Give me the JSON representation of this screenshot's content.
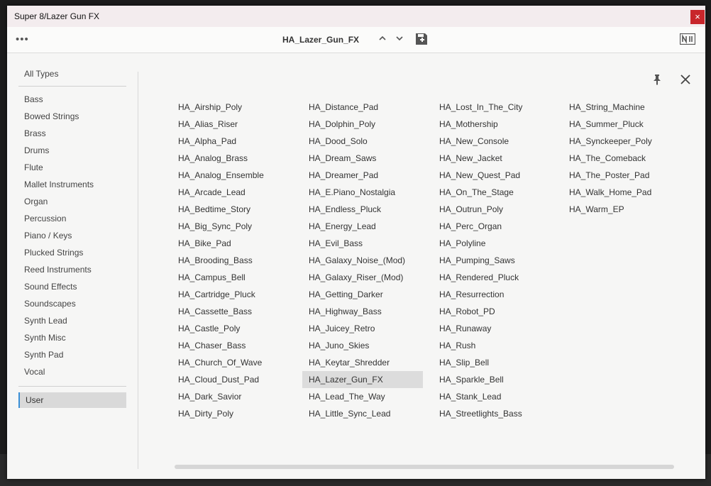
{
  "window": {
    "title": "Super 8/Lazer Gun FX",
    "close_glyph": "×"
  },
  "toolbar": {
    "menu_glyph": "•••",
    "preset_name": "HA_Lazer_Gun_FX",
    "icons": [
      "chevron-up-icon",
      "chevron-down-icon",
      "save-icon",
      "ni-logo-icon"
    ]
  },
  "browser": {
    "all_types": "All Types",
    "types": [
      "Bass",
      "Bowed Strings",
      "Brass",
      "Drums",
      "Flute",
      "Mallet Instruments",
      "Organ",
      "Percussion",
      "Piano / Keys",
      "Plucked Strings",
      "Reed Instruments",
      "Sound Effects",
      "Soundscapes",
      "Synth Lead",
      "Synth Misc",
      "Synth Pad",
      "Vocal"
    ],
    "user": "User",
    "selected_preset": "HA_Lazer_Gun_FX",
    "columns": [
      [
        "HA_Airship_Poly",
        "HA_Alias_Riser",
        "HA_Alpha_Pad",
        "HA_Analog_Brass",
        "HA_Analog_Ensemble",
        "HA_Arcade_Lead",
        "HA_Bedtime_Story",
        "HA_Big_Sync_Poly",
        "HA_Bike_Pad",
        "HA_Brooding_Bass",
        "HA_Campus_Bell",
        "HA_Cartridge_Pluck",
        "HA_Cassette_Bass",
        "HA_Castle_Poly",
        "HA_Chaser_Bass",
        "HA_Church_Of_Wave",
        "HA_Cloud_Dust_Pad",
        "HA_Dark_Savior",
        "HA_Dirty_Poly"
      ],
      [
        "HA_Distance_Pad",
        "HA_Dolphin_Poly",
        "HA_Dood_Solo",
        "HA_Dream_Saws",
        "HA_Dreamer_Pad",
        "HA_E.Piano_Nostalgia",
        "HA_Endless_Pluck",
        "HA_Energy_Lead",
        "HA_Evil_Bass",
        "HA_Galaxy_Noise_(Mod)",
        "HA_Galaxy_Riser_(Mod)",
        "HA_Getting_Darker",
        "HA_Highway_Bass",
        "HA_Juicey_Retro",
        "HA_Juno_Skies",
        "HA_Keytar_Shredder",
        "HA_Lazer_Gun_FX",
        "HA_Lead_The_Way",
        "HA_Little_Sync_Lead"
      ],
      [
        "HA_Lost_In_The_City",
        "HA_Mothership",
        "HA_New_Console",
        "HA_New_Jacket",
        "HA_New_Quest_Pad",
        "HA_On_The_Stage",
        "HA_Outrun_Poly",
        "HA_Perc_Organ",
        "HA_Polyline",
        "HA_Pumping_Saws",
        "HA_Rendered_Pluck",
        "HA_Resurrection",
        "HA_Robot_PD",
        "HA_Runaway",
        "HA_Rush",
        "HA_Slip_Bell",
        "HA_Sparkle_Bell",
        "HA_Stank_Lead",
        "HA_Streetlights_Bass"
      ],
      [
        "HA_String_Machine",
        "HA_Summer_Pluck",
        "HA_Synckeeper_Poly",
        "HA_The_Comeback",
        "HA_The_Poster_Pad",
        "HA_Walk_Home_Pad",
        "HA_Warm_EP"
      ]
    ]
  },
  "colors": {
    "close_red": "#c8262b",
    "selection_accent": "#3a8fd6",
    "background": "#f6f6f5"
  }
}
